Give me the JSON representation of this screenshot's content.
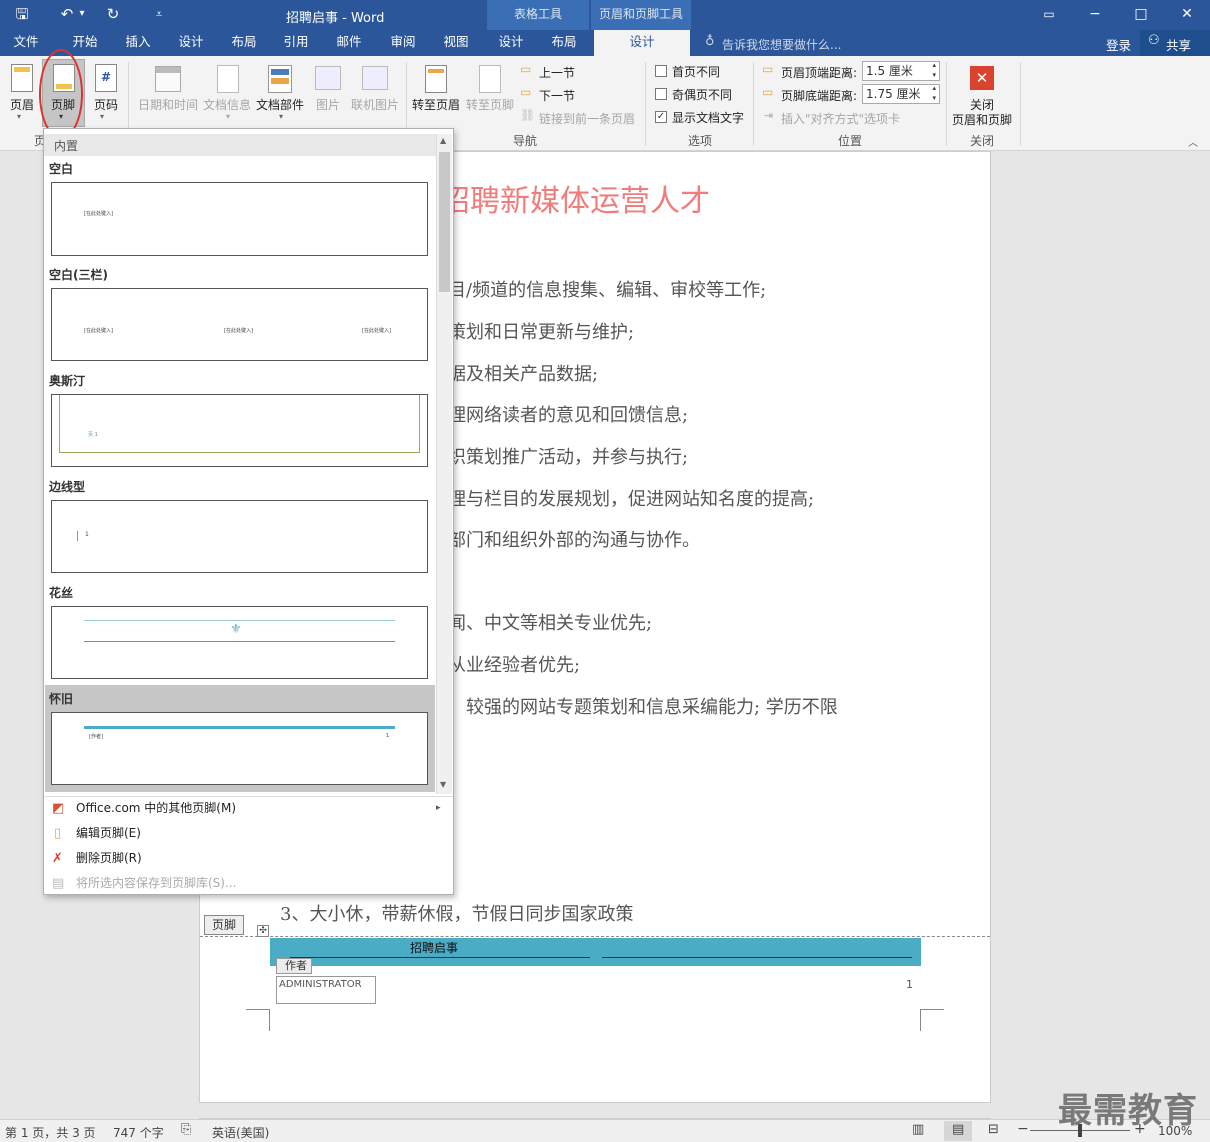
{
  "window": {
    "title": "招聘启事 - Word",
    "context_tab_groups": [
      "表格工具",
      "页眉和页脚工具"
    ],
    "min": "−",
    "max": "□",
    "close": "✕",
    "ribbon_opts": "▭"
  },
  "quick_access": {
    "save": "🖫",
    "undo": "↶",
    "undo_drop": "▾",
    "redo": "↻",
    "customize": "⩡"
  },
  "tabs": [
    "文件",
    "开始",
    "插入",
    "设计",
    "布局",
    "引用",
    "邮件",
    "审阅",
    "视图",
    "设计",
    "布局",
    "设计"
  ],
  "tell_me": "告诉我您想要做什么...",
  "account": {
    "signin": "登录",
    "share": "共享"
  },
  "ribbon": {
    "header": "页眉",
    "footer": "页脚",
    "page_number": "页码",
    "date_time": "日期和时间",
    "doc_info": "文档信息",
    "doc_parts": "文档部件",
    "picture": "图片",
    "online_picture": "联机图片",
    "goto_header": "转至页眉",
    "goto_footer": "转至页脚",
    "prev": "上一节",
    "next": "下一节",
    "link_prev": "链接到前一条页眉",
    "nav_group": "导航",
    "diff_first": "首页不同",
    "diff_odd_even": "奇偶页不同",
    "show_doc_text": "显示文档文字",
    "options_group": "选项",
    "header_dist_label": "页眉顶端距离:",
    "header_dist_value": "1.5 厘米",
    "footer_dist_label": "页脚底端距离:",
    "footer_dist_value": "1.75 厘米",
    "insert_align_tab": "插入\"对齐方式\"选项卡",
    "position_group": "位置",
    "close_line1": "关闭",
    "close_line2": "页眉和页脚",
    "close_group": "关闭",
    "hf_group_partial": "页"
  },
  "dropdown": {
    "section": "内置",
    "items": [
      {
        "title": "空白",
        "placeholder": "[在此处键入]"
      },
      {
        "title": "空白(三栏)",
        "placeholder": "[在此处键入]"
      },
      {
        "title": "奥斯汀",
        "placeholder": "页 1"
      },
      {
        "title": "边线型",
        "placeholder": "1"
      },
      {
        "title": "花丝",
        "placeholder": ""
      },
      {
        "title": "怀旧",
        "placeholder_left": "[作者]",
        "placeholder_right": "1"
      }
    ],
    "menu": [
      {
        "label": "Office.com 中的其他页脚(M)"
      },
      {
        "label": "编辑页脚(E)"
      },
      {
        "label": "删除页脚(R)"
      },
      {
        "label": "将所选内容保存到页脚库(S)..."
      }
    ]
  },
  "document": {
    "heading": "招聘新媒体运营人才",
    "lines": [
      "目/频道的信息搜集、编辑、审校等工作;",
      "策划和日常更新与维护;",
      "据及相关产品数据;",
      "理网络读者的意见和回馈信息;",
      "织策划推广活动，并参与执行;",
      "理与栏目的发展规划，促进网站知名度的提高;",
      "部门和组织外部的沟通与协作。",
      "闻、中文等相关专业优先;",
      "从业经验者优先;",
      "较强的网站专题策划和信息采编能力; 学历不限",
      "3、大小休，带薪休假，节假日同步国家政策"
    ],
    "partial_char": "",
    "footer_tag": "页脚",
    "footer_banner_text": "招聘启事",
    "author_tag": "作者",
    "author_value": "ADMINISTRATOR",
    "page_num": "1"
  },
  "status": {
    "page": "第 1 页，共 3 页",
    "words": "747 个字",
    "lang": "英语(美国)",
    "zoom": "100%"
  },
  "watermark": "最需教育",
  "colors": {
    "brand": "#2b579a",
    "heading": "#f07c7c",
    "banner": "#4bacc6",
    "annotation": "#e03030"
  }
}
